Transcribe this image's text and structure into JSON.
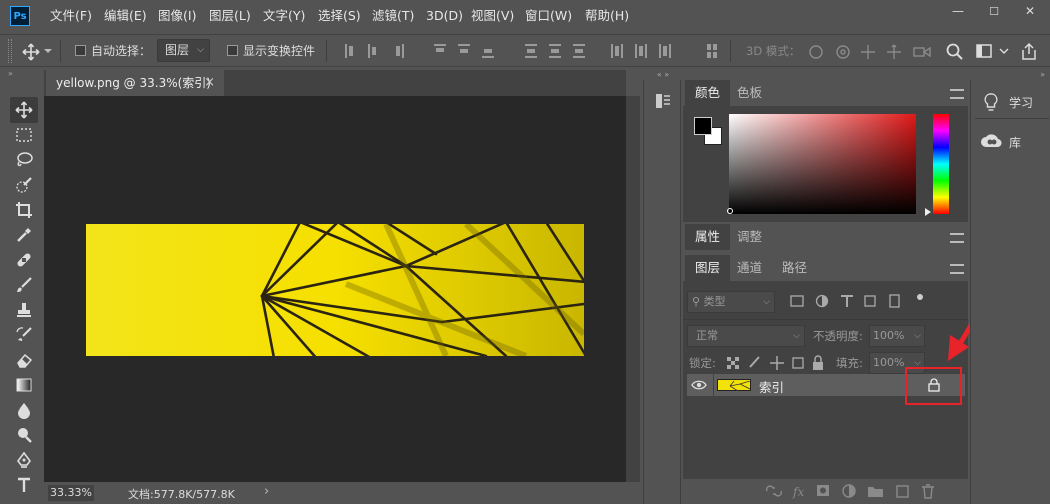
{
  "app": {
    "logo_text": "Ps"
  },
  "menu": [
    "文件(F)",
    "编辑(E)",
    "图像(I)",
    "图层(L)",
    "文字(Y)",
    "选择(S)",
    "滤镜(T)",
    "3D(D)",
    "视图(V)",
    "窗口(W)",
    "帮助(H)"
  ],
  "window_controls": {
    "minimize": "—",
    "maximize": "☐",
    "close": "✕"
  },
  "options": {
    "auto_select_label": "自动选择：",
    "auto_select_target": "图层",
    "show_transform_label": "显示变换控件",
    "mode_3d_label": "3D 模式："
  },
  "document": {
    "tab_title": "yellow.png @ 33.3%(索引)",
    "tab_close": "×",
    "zoom": "33.33%",
    "doc_size": "文档:577.8K/577.8K",
    "status_arrow": "›"
  },
  "color_panel": {
    "tabs": [
      "颜色",
      "色板"
    ]
  },
  "properties_panel": {
    "tabs": [
      "属性",
      "调整"
    ]
  },
  "layers_panel": {
    "tabs": [
      "图层",
      "通道",
      "路径"
    ],
    "filter_kind": "类型",
    "blend_mode": "正常",
    "opacity_label": "不透明度:",
    "opacity_value": "100%",
    "lock_label": "锁定:",
    "fill_label": "填充:",
    "fill_value": "100%",
    "layers": [
      {
        "name": "索引",
        "visible": true,
        "locked": true
      }
    ]
  },
  "right_panel": {
    "learn": "学习",
    "library": "库"
  },
  "colors": {
    "accent_red": "#e8232a",
    "image_yellow": "#f3e10a",
    "ps_blue": "#31a8ff"
  }
}
